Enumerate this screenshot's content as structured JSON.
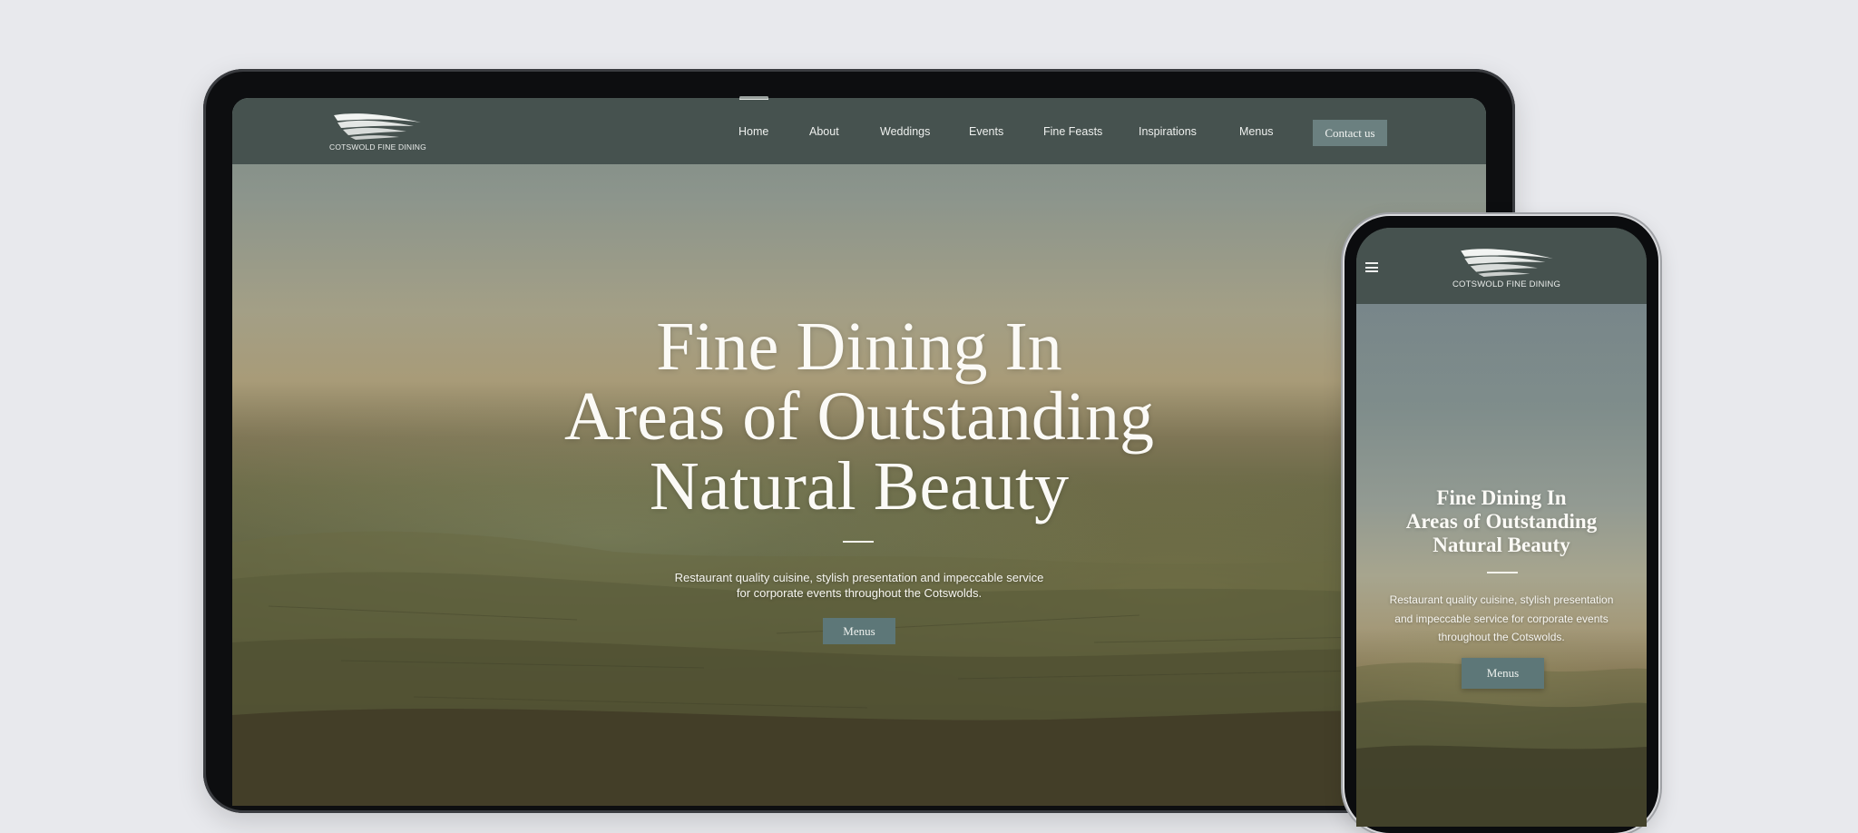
{
  "brand": {
    "name": "COTSWOLD FINE DINING"
  },
  "laptop": {
    "nav": {
      "items": [
        {
          "label": "Home"
        },
        {
          "label": "About"
        },
        {
          "label": "Weddings"
        },
        {
          "label": "Events"
        },
        {
          "label": "Fine Feasts"
        },
        {
          "label": "Inspirations"
        },
        {
          "label": "Menus"
        }
      ],
      "contact_label": "Contact us",
      "active_item": "Home"
    },
    "hero": {
      "title_lines": [
        "Fine Dining In",
        "Areas of Outstanding",
        "Natural Beauty"
      ],
      "subtitle_lines": [
        "Restaurant quality cuisine, stylish presentation and impeccable service",
        "for corporate events throughout the Cotswolds."
      ],
      "button_label": "Menus"
    }
  },
  "phone": {
    "hero": {
      "title_lines": [
        "Fine Dining In",
        "Areas of Outstanding",
        "Natural Beauty"
      ],
      "subtitle_lines": [
        "Restaurant quality cuisine, stylish presentation",
        "and impeccable service for corporate events",
        "throughout the Cotswolds."
      ],
      "button_label": "Menus"
    }
  },
  "colors": {
    "page_background": "#e8e9ed",
    "nav_background": "#46524f",
    "button_background": "#5d7778",
    "contact_button_background": "#6b8080",
    "text_light": "#fbfaf6"
  },
  "icons": {
    "logo": "swoosh-hills-logo",
    "menu": "hamburger-icon"
  }
}
